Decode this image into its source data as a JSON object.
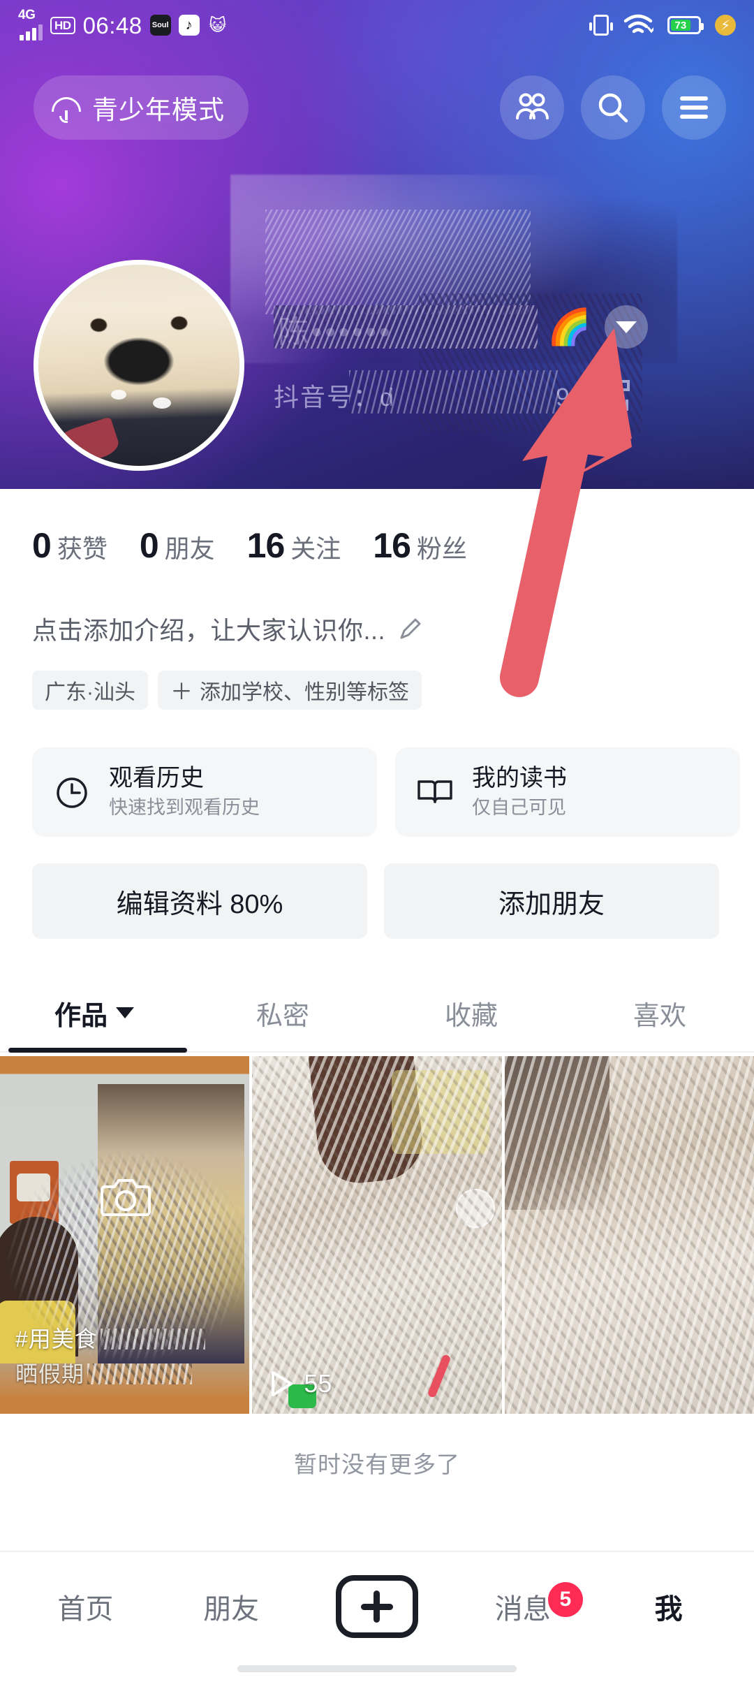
{
  "statusbar": {
    "network": "4G",
    "hd": "HD",
    "time": "06:48",
    "app_icons": [
      "soul-app-icon",
      "douyin-app-icon",
      "cat-app-icon"
    ],
    "vibrate_icon": "vibrate-icon",
    "wifi_icon": "wifi-icon",
    "battery_level": "73",
    "charge_icon": "fast-charge-icon"
  },
  "topnav": {
    "teen_mode_label": "青少年模式",
    "umbrella_icon": "umbrella-icon",
    "friends_icon": "people-icon",
    "search_icon": "search-icon",
    "menu_icon": "hamburger-menu-icon"
  },
  "profile": {
    "avatar_alt": "golden-retriever-puppy-avatar",
    "username_redacted": "陈••••••",
    "username_emoji": "🌈",
    "expand_icon": "chevron-down-icon",
    "douyin_id_label": "抖音号：d",
    "douyin_id_tail": "99",
    "qr_icon": "qr-code-icon"
  },
  "stats": [
    {
      "num": "0",
      "label": "获赞"
    },
    {
      "num": "0",
      "label": "朋友"
    },
    {
      "num": "16",
      "label": "关注"
    },
    {
      "num": "16",
      "label": "粉丝"
    }
  ],
  "bio": {
    "text": "点击添加介绍，让大家认识你...",
    "edit_icon": "pencil-icon"
  },
  "tags": [
    {
      "plus": "",
      "text": "广东·汕头"
    },
    {
      "plus": "＋",
      "text": "添加学校、性别等标签"
    }
  ],
  "cards": [
    {
      "icon": "clock-icon",
      "title": "观看历史",
      "subtitle": "快速找到观看历史"
    },
    {
      "icon": "book-icon",
      "title": "我的读书",
      "subtitle": "仅自己可见"
    },
    {
      "icon": "music-note-icon",
      "title": "",
      "subtitle": ""
    }
  ],
  "actions": [
    {
      "label": "编辑资料 80%"
    },
    {
      "label": "添加朋友"
    }
  ],
  "tabs": [
    {
      "label": "作品",
      "caret": true,
      "active": true
    },
    {
      "label": "私密",
      "caret": false,
      "active": false
    },
    {
      "label": "收藏",
      "caret": false,
      "active": false
    },
    {
      "label": "喜欢",
      "caret": false,
      "active": false
    }
  ],
  "grid": [
    {
      "caption1": "#用美食",
      "caption2": "晒假期",
      "camera_icon": "camera-icon",
      "plays": ""
    },
    {
      "caption1": "",
      "caption2": "",
      "camera_icon": "",
      "plays": "55",
      "play_icon": "play-icon"
    },
    {
      "caption1": "",
      "caption2": "",
      "camera_icon": "",
      "plays": ""
    }
  ],
  "footer": {
    "no_more_text": "暂时没有更多了"
  },
  "bottomnav": [
    {
      "label": "首页",
      "active": false,
      "badge": ""
    },
    {
      "label": "朋友",
      "active": false,
      "badge": ""
    },
    {
      "label": "",
      "active": false,
      "badge": "",
      "icon": "plus-create-icon"
    },
    {
      "label": "消息",
      "active": false,
      "badge": "5"
    },
    {
      "label": "我",
      "active": true,
      "badge": ""
    }
  ],
  "annotation": {
    "arrow_color": "#e8606a",
    "arrow_name": "red-pointer-arrow"
  },
  "colors": {
    "accent_red": "#fe2c55",
    "text_primary": "#161823",
    "text_secondary": "#8a8e99",
    "chip_bg": "#f2f3f5",
    "battery_green": "#25d04a"
  }
}
